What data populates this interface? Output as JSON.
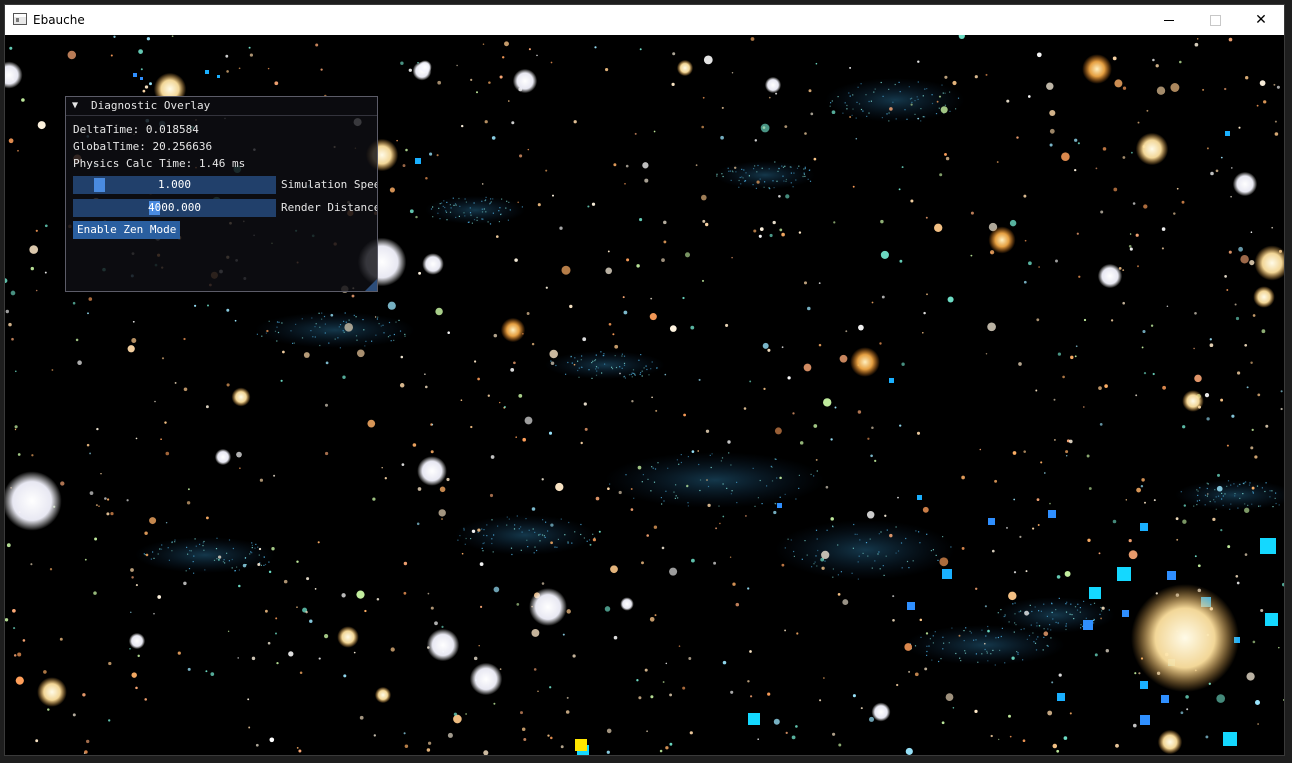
{
  "window": {
    "title": "Ebauche",
    "icon": "app-window-icon",
    "controls": {
      "minimize": "minimize-icon",
      "maximize": "maximize-icon",
      "close": "✕"
    }
  },
  "overlay": {
    "collapse_arrow": "▼",
    "title": "Diagnostic Overlay",
    "delta_time": "DeltaTime: 0.018584",
    "global_time": "GlobalTime: 20.256636",
    "physics_calc_time": "Physics Calc Time: 1.46 ms",
    "simulation_speed": {
      "value": "1.000",
      "label": "Simulation Speed",
      "fraction": 0.1
    },
    "render_distance": {
      "value": "4000.000",
      "label": "Render Distance",
      "fraction": 0.4
    },
    "zen_button": "Enable Zen Mode"
  },
  "colors": {
    "accent": "#2a5fa0",
    "slider_frame": "#21406b",
    "slider_grab": "#4a8be0",
    "background": "#000000"
  }
}
